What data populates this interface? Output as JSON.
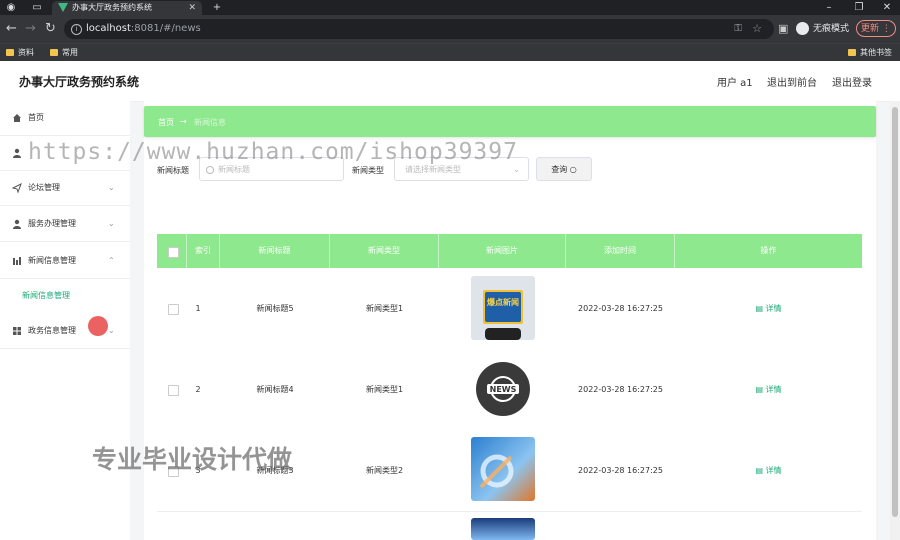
{
  "browser": {
    "tab_title": "办事大厅政务预约系统",
    "url_host": "localhost",
    "url_path": ":8081/#/news",
    "incognito_label": "无痕模式",
    "update_label": "更新",
    "bookmarks": [
      "资料",
      "常用"
    ],
    "other_bookmarks": "其他书签"
  },
  "header": {
    "title": "办事大厅政务预约系统",
    "user": "用户 a1",
    "front_link": "退出到前台",
    "logout": "退出登录"
  },
  "sidebar": {
    "items": [
      {
        "label": "首页",
        "icon": "home-icon"
      },
      {
        "label": "",
        "icon": "user-icon"
      },
      {
        "label": "论坛管理",
        "icon": "send-icon"
      },
      {
        "label": "服务办理管理",
        "icon": "user-icon"
      },
      {
        "label": "新闻信息管理",
        "icon": "chart-icon"
      },
      {
        "label": "政务信息管理",
        "icon": "grid-icon"
      }
    ],
    "sub_item": "新闻信息管理"
  },
  "breadcrumb": {
    "home": "首页",
    "arrow": "→",
    "current": "新闻信息"
  },
  "search": {
    "title_label": "新闻标题",
    "title_placeholder": "新闻标题",
    "type_label": "新闻类型",
    "type_placeholder": "请选择新闻类型",
    "query_button": "查询"
  },
  "table": {
    "headers": [
      "",
      "索引",
      "新闻标题",
      "新闻类型",
      "新闻图片",
      "添加时间",
      "操作"
    ],
    "rows": [
      {
        "index": "1",
        "title": "新闻标题5",
        "type": "新闻类型1",
        "image": "爆点新闻",
        "time": "2022-03-28 16:27:25",
        "action": "详情"
      },
      {
        "index": "2",
        "title": "新闻标题4",
        "type": "新闻类型1",
        "image": "NEWS",
        "time": "2022-03-28 16:27:25",
        "action": "详情"
      },
      {
        "index": "3",
        "title": "新闻标题3",
        "type": "新闻类型2",
        "image": "",
        "time": "2022-03-28 16:27:25",
        "action": "详情"
      }
    ]
  },
  "watermarks": {
    "url": "https://www.huzhan.com/ishop39397",
    "text": "专业毕业设计代做"
  },
  "colors": {
    "accent": "#8ee88e",
    "link": "#19a974"
  }
}
